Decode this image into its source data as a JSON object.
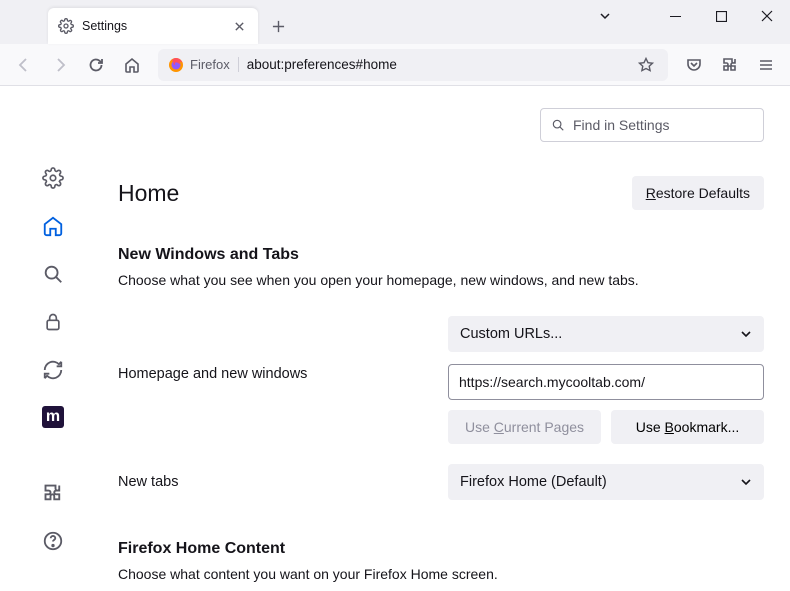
{
  "window": {
    "tab_title": "Settings",
    "new_tab_tooltip": "+"
  },
  "toolbar": {
    "identity": "Firefox",
    "url": "about:preferences#home"
  },
  "search": {
    "placeholder": "Find in Settings"
  },
  "page": {
    "title": "Home",
    "restore": "Restore Defaults"
  },
  "section_newwin": {
    "heading": "New Windows and Tabs",
    "desc": "Choose what you see when you open your homepage, new windows, and new tabs.",
    "homepage_label": "Homepage and new windows",
    "homepage_select": "Custom URLs...",
    "homepage_url": "https://search.mycooltab.com/",
    "use_current": "Use Current Pages",
    "use_bookmark": "Use Bookmark...",
    "newtabs_label": "New tabs",
    "newtabs_select": "Firefox Home (Default)"
  },
  "section_content": {
    "heading": "Firefox Home Content",
    "desc": "Choose what content you want on your Firefox Home screen."
  }
}
